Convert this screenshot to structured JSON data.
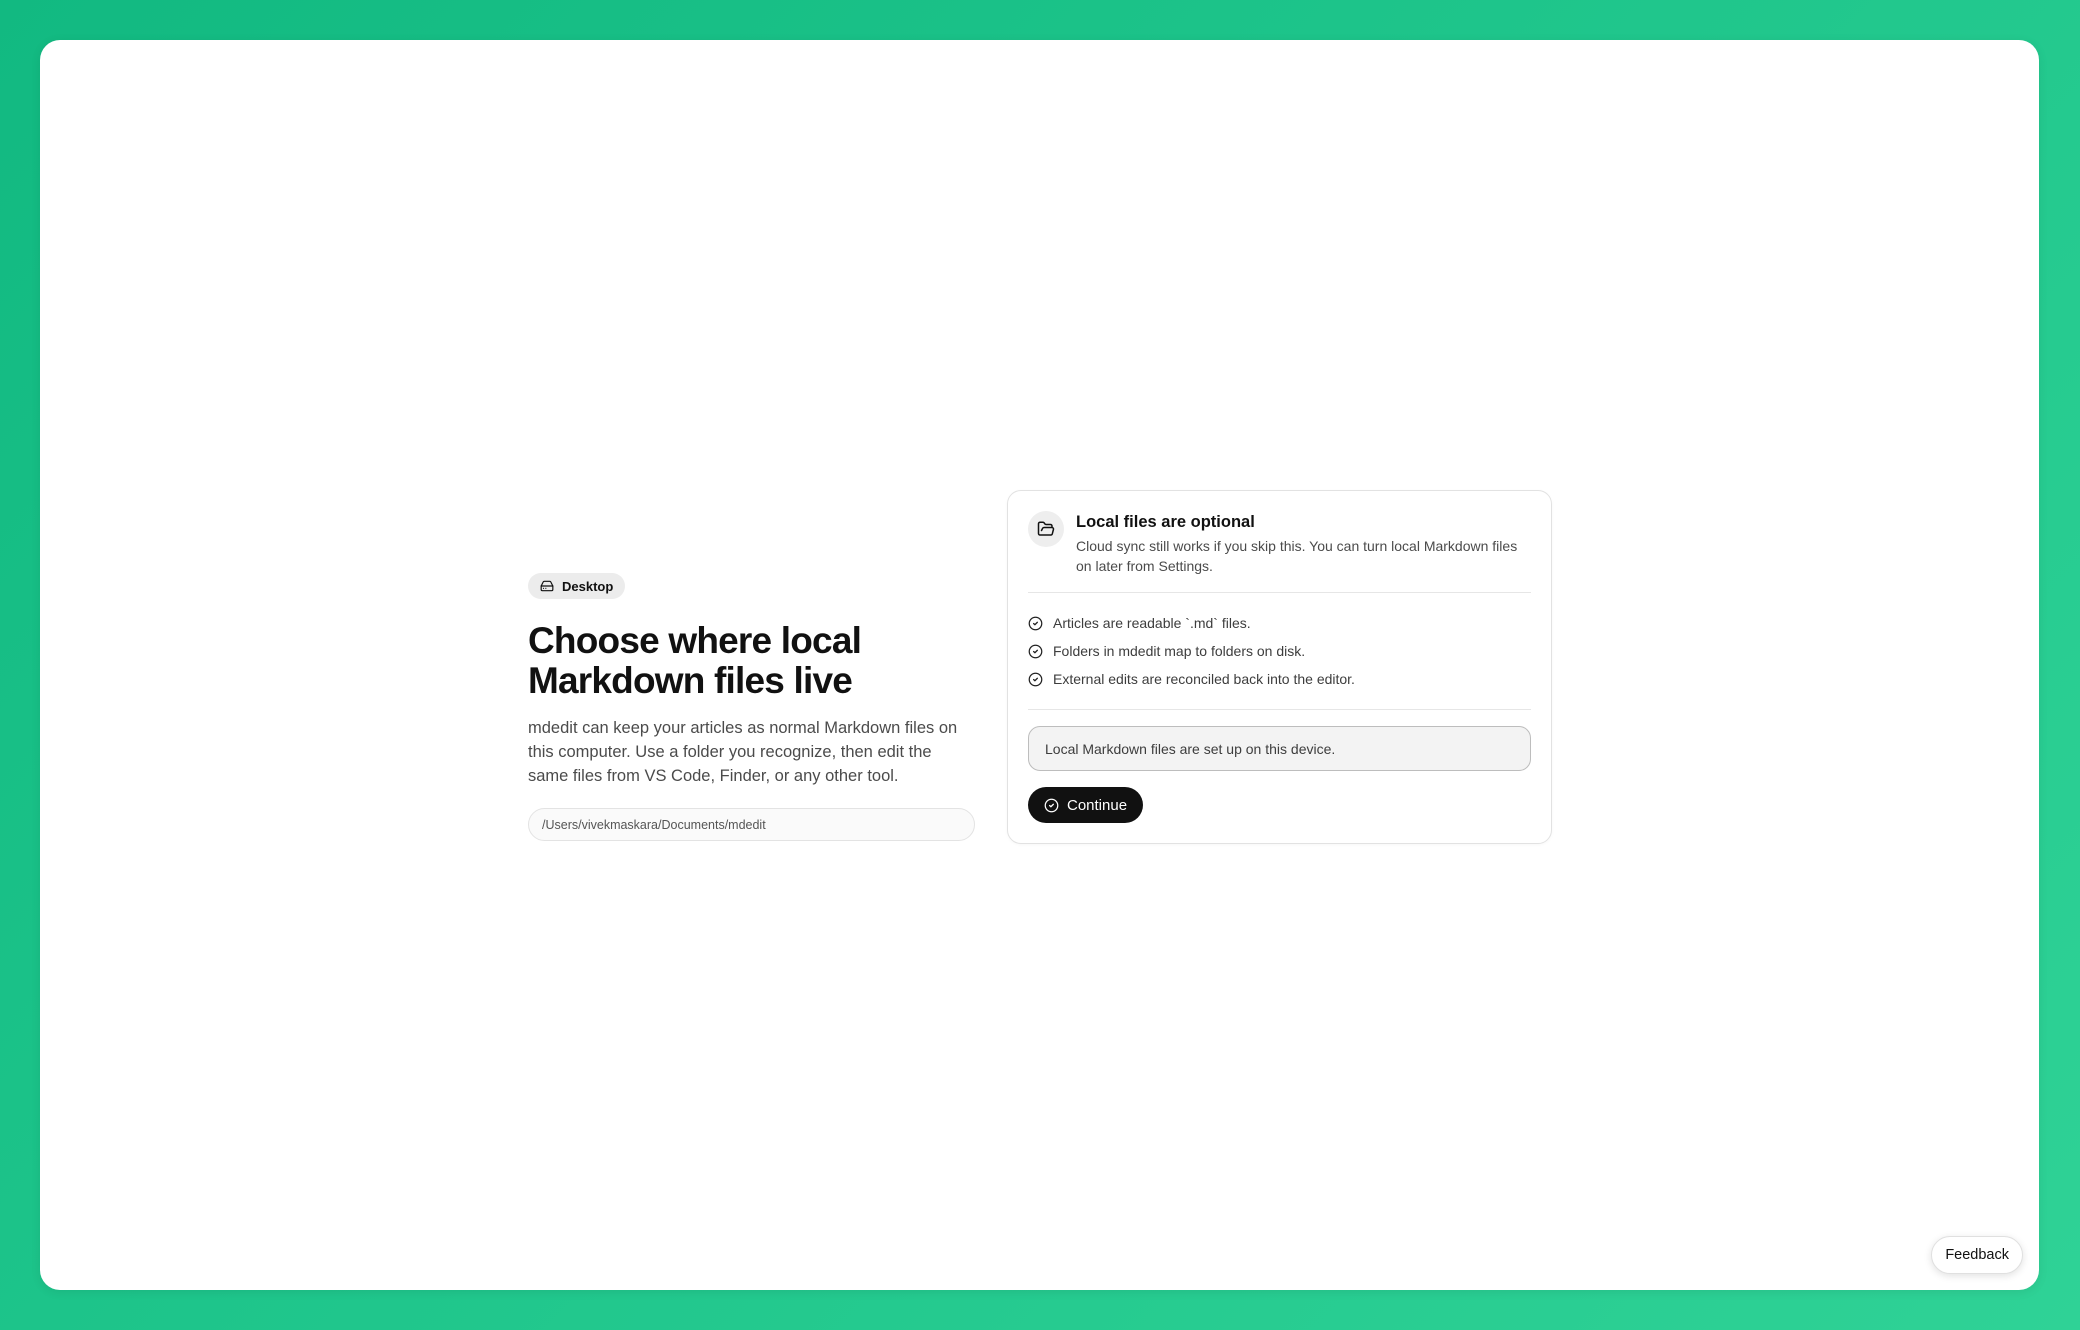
{
  "badge": {
    "icon": "hard-drive-icon",
    "label": "Desktop"
  },
  "hero": {
    "title": "Choose where local Markdown files live",
    "description": "mdedit can keep your articles as normal Markdown files on this computer. Use a folder you recognize, then edit the same files from VS Code, Finder, or any other tool.",
    "path_value": "/Users/vivekmaskara/Documents/mdedit"
  },
  "card": {
    "icon": "folder-open-icon",
    "title": "Local files are optional",
    "description": "Cloud sync still works if you skip this. You can turn local Markdown files on later from Settings.",
    "checklist": [
      "Articles are readable `.md` files.",
      "Folders in mdedit map to folders on disk.",
      "External edits are reconciled back into the editor."
    ],
    "status_text": "Local Markdown files are set up on this device.",
    "continue_label": "Continue"
  },
  "feedback_label": "Feedback",
  "colors": {
    "background_start": "#12b981",
    "background_end": "#2fd296",
    "primary_button": "#111111"
  }
}
